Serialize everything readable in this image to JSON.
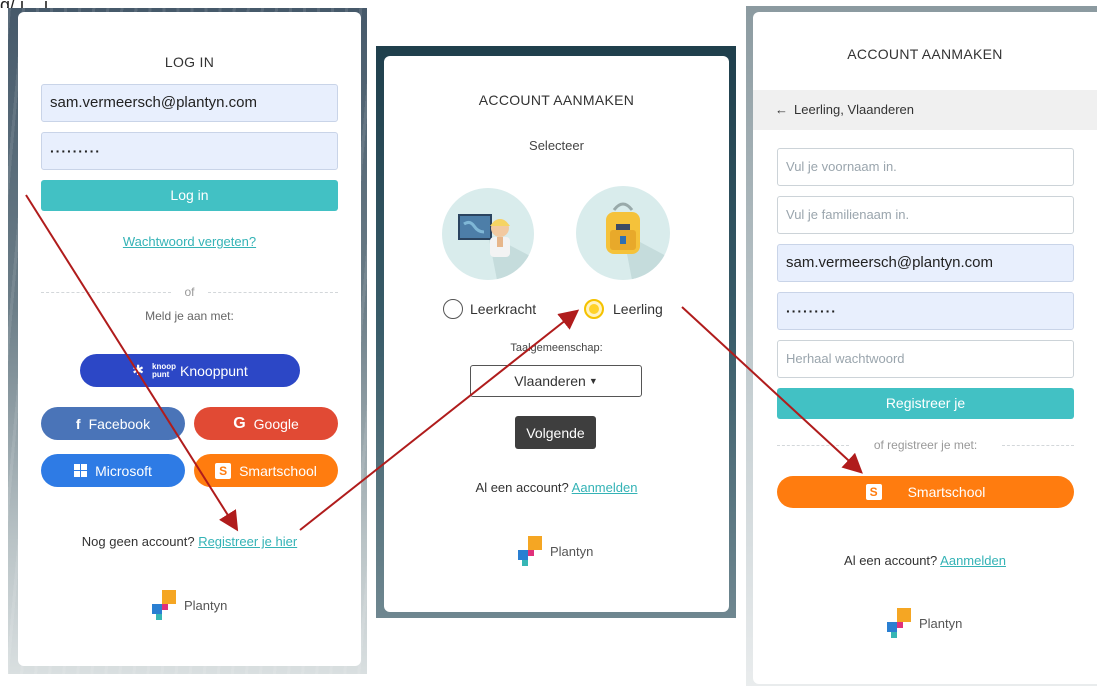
{
  "top_cropped_text": "g/ i .. j",
  "login": {
    "title": "LOG IN",
    "email": "sam.vermeersch@plantyn.com",
    "password": "·········",
    "login_button": "Log in",
    "forgot_link": "Wachtwoord vergeten?",
    "divider": "of",
    "signin_with": "Meld je aan met:",
    "knooppunt_logo": "knoop punt",
    "knooppunt": "Knooppunt",
    "facebook": "Facebook",
    "google": "Google",
    "microsoft": "Microsoft",
    "smartschool": "Smartschool",
    "no_account": "Nog geen account?",
    "register_link": "Registreer je hier",
    "brand": "Plantyn"
  },
  "select_role": {
    "title": "ACCOUNT AANMAKEN",
    "subtitle": "Selecteer",
    "teacher": "Leerkracht",
    "student": "Leerling",
    "language_label": "Taalgemeenschap:",
    "language_value": "Vlaanderen",
    "next_button": "Volgende",
    "have_account": "Al een account?",
    "signin_link": "Aanmelden",
    "brand": "Plantyn",
    "selected_role": "Leerling"
  },
  "register": {
    "title": "ACCOUNT AANMAKEN",
    "back_label": "Leerling, Vlaanderen",
    "first_name_placeholder": "Vul je voornaam in.",
    "last_name_placeholder": "Vul je familienaam in.",
    "email": "sam.vermeersch@plantyn.com",
    "password": "·········",
    "repeat_password_placeholder": "Herhaal wachtwoord",
    "register_button": "Registreer je",
    "divider": "of registreer je met:",
    "smartschool": "Smartschool",
    "have_account": "Al een account?",
    "signin_link": "Aanmelden",
    "brand": "Plantyn"
  },
  "colors": {
    "teal": "#42c1c4",
    "smartschool_orange": "#ff7c0f",
    "arrow_red": "#b01c1c"
  }
}
